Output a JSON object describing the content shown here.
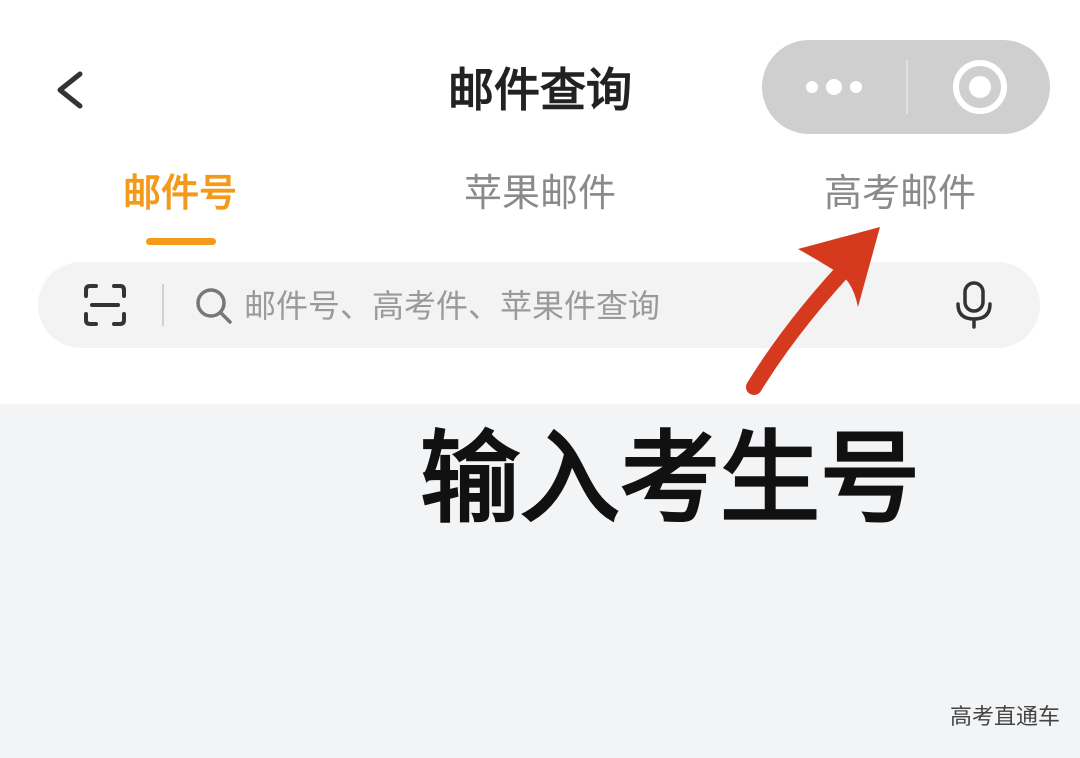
{
  "header": {
    "title": "邮件查询",
    "back_icon": "chevron-left-icon",
    "capsule": {
      "more_icon": "more-dots-icon",
      "close_icon": "close-circle-icon"
    }
  },
  "tabs": [
    {
      "label": "邮件号",
      "active": true
    },
    {
      "label": "苹果邮件",
      "active": false
    },
    {
      "label": "高考邮件",
      "active": false
    }
  ],
  "search": {
    "placeholder": "邮件号、高考件、苹果件查询",
    "value": "",
    "scan_icon": "scan-icon",
    "search_icon": "search-icon",
    "mic_icon": "microphone-icon"
  },
  "annotation": {
    "text": "输入考生号",
    "arrow_color": "#d63a1e"
  },
  "watermark": {
    "text": "高考直通车"
  },
  "colors": {
    "accent": "#f39a1b",
    "capsule": "#cfcfcf",
    "content_bg": "#f3f4f6"
  }
}
